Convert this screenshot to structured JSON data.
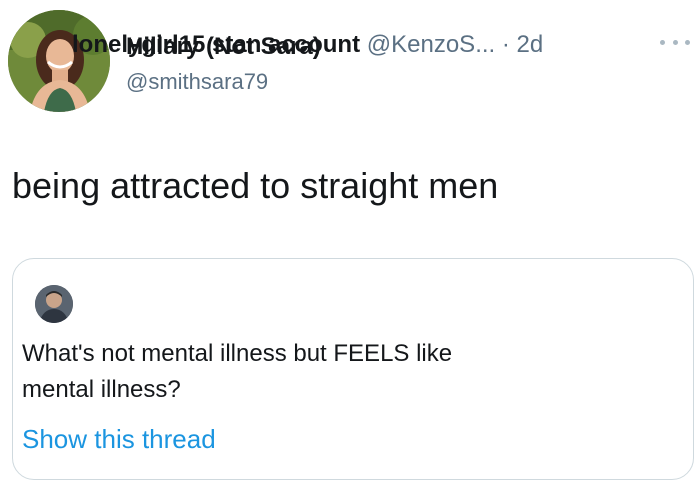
{
  "tweet": {
    "display_name": "Hillary (Not Sara)",
    "handle": "@smithsara79",
    "text": "being attracted to straight men",
    "avatar_icon": "profile-photo",
    "more_icon": "more-options-icon"
  },
  "quoted_tweet": {
    "display_name": "lonelygirl15 stan account",
    "handle": "@KenzoS...",
    "separator": "·",
    "time": "2d",
    "text_line_1": "What's not mental illness but FEELS like",
    "text_line_2": "mental illness?",
    "show_thread": "Show this thread",
    "avatar_icon": "profile-photo"
  },
  "colors": {
    "primary_text": "#14171a",
    "secondary_text": "#5b7083",
    "link": "#1b95e0",
    "border": "#cfd9de"
  }
}
